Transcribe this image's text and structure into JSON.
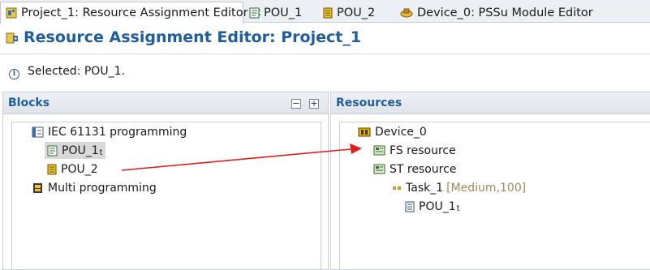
{
  "tabs": [
    {
      "label": "Project_1: Resource Assignment Editor",
      "active": true,
      "closable": true,
      "icon": "resource-editor-icon"
    },
    {
      "label": "POU_1",
      "active": false,
      "icon": "pou-st-icon"
    },
    {
      "label": "POU_2",
      "active": false,
      "icon": "pou-icon"
    },
    {
      "label": "Device_0: PSSu Module Editor",
      "active": false,
      "icon": "module-editor-icon"
    }
  ],
  "tab_close_glyph": "✕",
  "editor": {
    "title": "Resource Assignment Editor: Project_1",
    "info_text": "Selected: POU_1."
  },
  "blocks": {
    "title": "Blocks",
    "collapse_glyph": "−",
    "expand_glyph": "+",
    "tree": {
      "iec": "IEC 61131 programming",
      "pou1": "POU_1",
      "pou1_suffix": "t",
      "pou2": "POU_2",
      "multi": "Multi programming"
    }
  },
  "resources": {
    "title": "Resources",
    "tree": {
      "device": "Device_0",
      "fs": "FS resource",
      "st": "ST resource",
      "task": "Task_1",
      "task_detail": "[Medium,100]",
      "pou1": "POU_1",
      "pou1_suffix": "t"
    }
  },
  "colors": {
    "accent": "#1f5d9e",
    "arrow": "#e02020",
    "selection": "#d9d9d9",
    "task_detail": "#a08a5e"
  }
}
